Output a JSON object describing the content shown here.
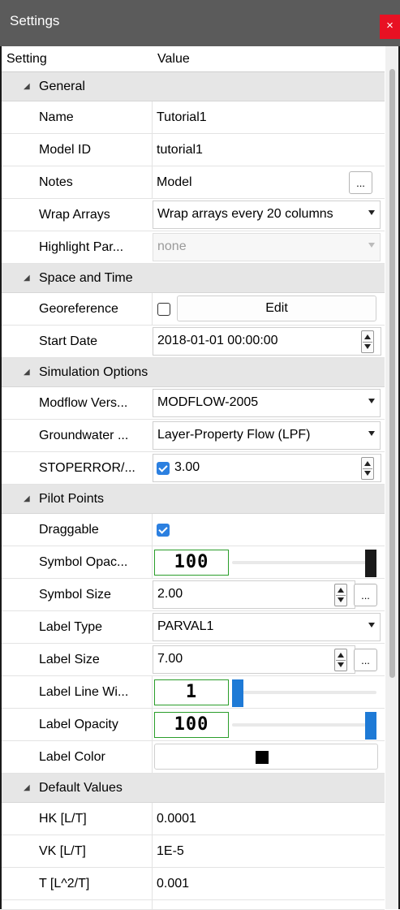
{
  "window": {
    "title": "Settings",
    "close_label": "×"
  },
  "columns": {
    "setting": "Setting",
    "value": "Value"
  },
  "general": {
    "label": "General",
    "name": {
      "label": "Name",
      "value": "Tutorial1"
    },
    "model_id": {
      "label": "Model ID",
      "value": "tutorial1"
    },
    "notes": {
      "label": "Notes",
      "value": "Model",
      "button": "..."
    },
    "wrap_arrays": {
      "label": "Wrap Arrays",
      "value": "Wrap arrays every 20 columns"
    },
    "highlight": {
      "label": "Highlight Par...",
      "value": "none"
    }
  },
  "space_time": {
    "label": "Space and Time",
    "georeference": {
      "label": "Georeference",
      "checked": false,
      "button": "Edit"
    },
    "start_date": {
      "label": "Start Date",
      "value": "2018-01-01 00:00:00"
    }
  },
  "simulation": {
    "label": "Simulation Options",
    "modflow_version": {
      "label": "Modflow Vers...",
      "value": "MODFLOW-2005"
    },
    "groundwater": {
      "label": "Groundwater ...",
      "value": "Layer-Property Flow (LPF)"
    },
    "stoperror": {
      "label": "STOPERROR/...",
      "checked": true,
      "value": "3.00"
    }
  },
  "pilot_points": {
    "label": "Pilot Points",
    "draggable": {
      "label": "Draggable",
      "checked": true
    },
    "symbol_opacity": {
      "label": "Symbol Opac...",
      "display": "100",
      "level": 1.0,
      "thumb_color": "#1a1a1a"
    },
    "symbol_size": {
      "label": "Symbol Size",
      "value": "2.00",
      "button": "..."
    },
    "label_type": {
      "label": "Label Type",
      "value": "PARVAL1"
    },
    "label_size": {
      "label": "Label Size",
      "value": "7.00",
      "button": "..."
    },
    "label_line_width": {
      "label": "Label Line Wi...",
      "display": "1",
      "level": 0.0,
      "thumb_color": "#1e7ad6"
    },
    "label_opacity": {
      "label": "Label Opacity",
      "display": "100",
      "level": 1.0,
      "thumb_color": "#1e7ad6"
    },
    "label_color": {
      "label": "Label Color",
      "swatch": "#000000"
    }
  },
  "defaults": {
    "label": "Default Values",
    "hk": {
      "label": "HK [L/T]",
      "value": "0.0001"
    },
    "vk": {
      "label": "VK [L/T]",
      "value": "1E-5"
    },
    "t": {
      "label": "T [L^2/T]",
      "value": "0.001"
    }
  }
}
